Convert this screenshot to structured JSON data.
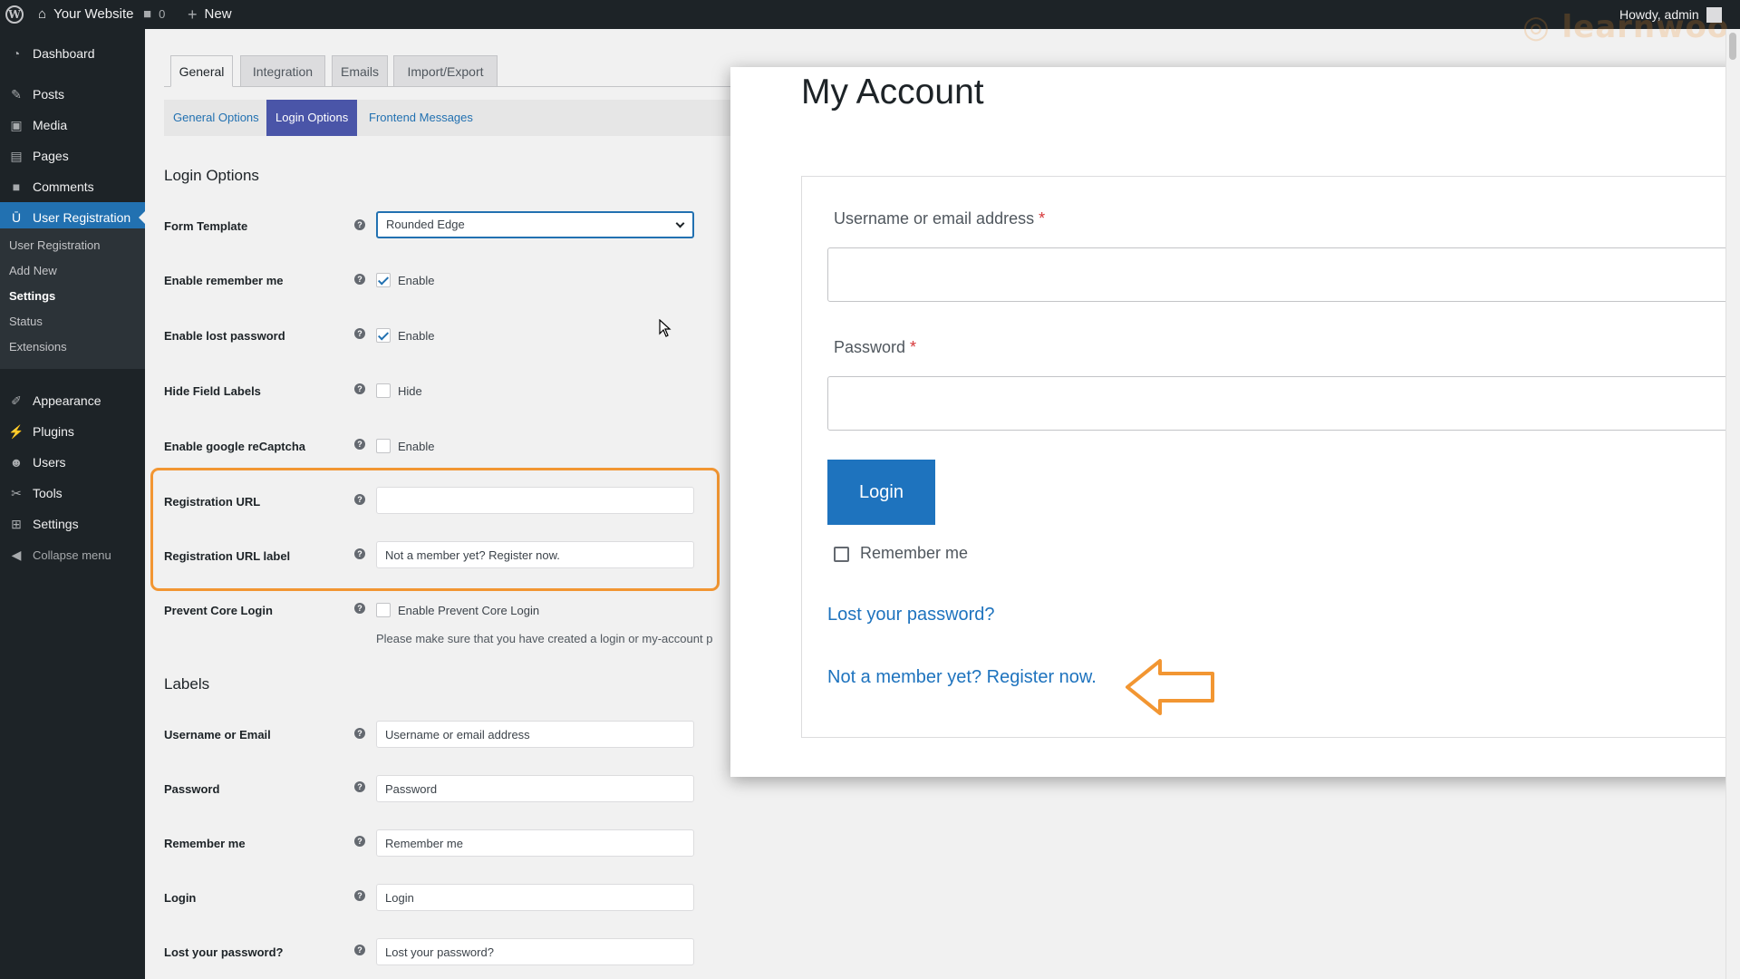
{
  "adminbar": {
    "site_name": "Your Website",
    "comments_count": "0",
    "new_label": "New",
    "greeting": "Howdy, admin",
    "watermark": "learnwoo"
  },
  "sidebar": {
    "items": [
      {
        "label": "Dashboard",
        "icon": "dashboard-icon"
      },
      {
        "label": "Posts",
        "icon": "pin-icon"
      },
      {
        "label": "Media",
        "icon": "media-icon"
      },
      {
        "label": "Pages",
        "icon": "pages-icon"
      },
      {
        "label": "Comments",
        "icon": "comment-icon"
      },
      {
        "label": "User Registration",
        "icon": "user-registration-icon"
      },
      {
        "label": "Appearance",
        "icon": "brush-icon"
      },
      {
        "label": "Plugins",
        "icon": "plugin-icon"
      },
      {
        "label": "Users",
        "icon": "users-icon"
      },
      {
        "label": "Tools",
        "icon": "wrench-icon"
      },
      {
        "label": "Settings",
        "icon": "settings-icon"
      },
      {
        "label": "Collapse menu",
        "icon": "collapse-icon"
      }
    ],
    "submenu": [
      "User Registration",
      "Add New",
      "Settings",
      "Status",
      "Extensions"
    ]
  },
  "tabs": [
    "General",
    "Integration",
    "Emails",
    "Import/Export"
  ],
  "subtabs": [
    "General Options",
    "Login Options",
    "Frontend Messages"
  ],
  "login_options": {
    "title": "Login Options",
    "form_template_label": "Form Template",
    "form_template_value": "Rounded Edge",
    "remember_label": "Enable remember me",
    "remember_text": "Enable",
    "lost_label": "Enable lost password",
    "lost_text": "Enable",
    "hide_labels_label": "Hide Field Labels",
    "hide_labels_text": "Hide",
    "recaptcha_label": "Enable google reCaptcha",
    "recaptcha_text": "Enable",
    "reg_url_label": "Registration URL",
    "reg_url_value": "",
    "reg_url_label_label": "Registration URL label",
    "reg_url_label_value": "Not a member yet? Register now.",
    "prevent_label": "Prevent Core Login",
    "prevent_text": "Enable Prevent Core Login",
    "prevent_note": "Please make sure that you have created a login or my-account p"
  },
  "labels": {
    "title": "Labels",
    "rows": [
      {
        "label": "Username or Email",
        "value": "Username or email address"
      },
      {
        "label": "Password",
        "value": "Password"
      },
      {
        "label": "Remember me",
        "value": "Remember me"
      },
      {
        "label": "Login",
        "value": "Login"
      },
      {
        "label": "Lost your password?",
        "value": "Lost your password?"
      }
    ]
  },
  "preview": {
    "title": "My Account",
    "username_label": "Username or email address",
    "password_label": "Password",
    "required_mark": "*",
    "login_button": "Login",
    "remember_label": "Remember me",
    "lost_link": "Lost your password?",
    "register_link": "Not a member yet? Register now."
  },
  "colors": {
    "accent": "#2271b1",
    "highlight": "#f29632",
    "admin_bar": "#1d2327"
  }
}
